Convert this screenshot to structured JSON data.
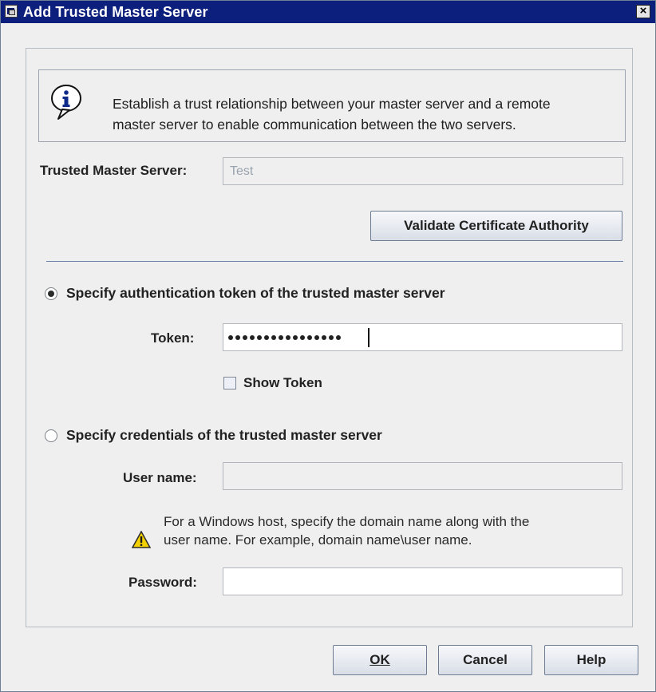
{
  "window": {
    "title": "Add Trusted Master Server",
    "close_label": "×"
  },
  "info": {
    "icon": "info-icon",
    "line1": "Establish a trust relationship between your master server and a remote",
    "line2": "master server to enable communication between the two servers."
  },
  "trusted_master": {
    "label": "Trusted Master Server:",
    "value": "Test"
  },
  "buttons": {
    "validate_ca": "Validate Certificate Authority",
    "ok": "OK",
    "cancel": "Cancel",
    "help": "Help"
  },
  "options": {
    "token": {
      "label": "Specify authentication token of the trusted master server",
      "selected": true,
      "token_label": "Token:",
      "masked_value": "••••••••••••••••",
      "show_token_label": "Show Token"
    },
    "credentials": {
      "label": "Specify credentials of the trusted master server",
      "selected": false,
      "username_label": "User name:",
      "username_value": "",
      "note_line1": "For a Windows host, specify the domain name along with the",
      "note_line2": "user name. For example, domain name\\user name.",
      "password_label": "Password:",
      "password_value": ""
    }
  },
  "colors": {
    "titlebar": "#0d1f7c",
    "dialog_bg": "#efeff0",
    "separator": "#6e82aa"
  }
}
